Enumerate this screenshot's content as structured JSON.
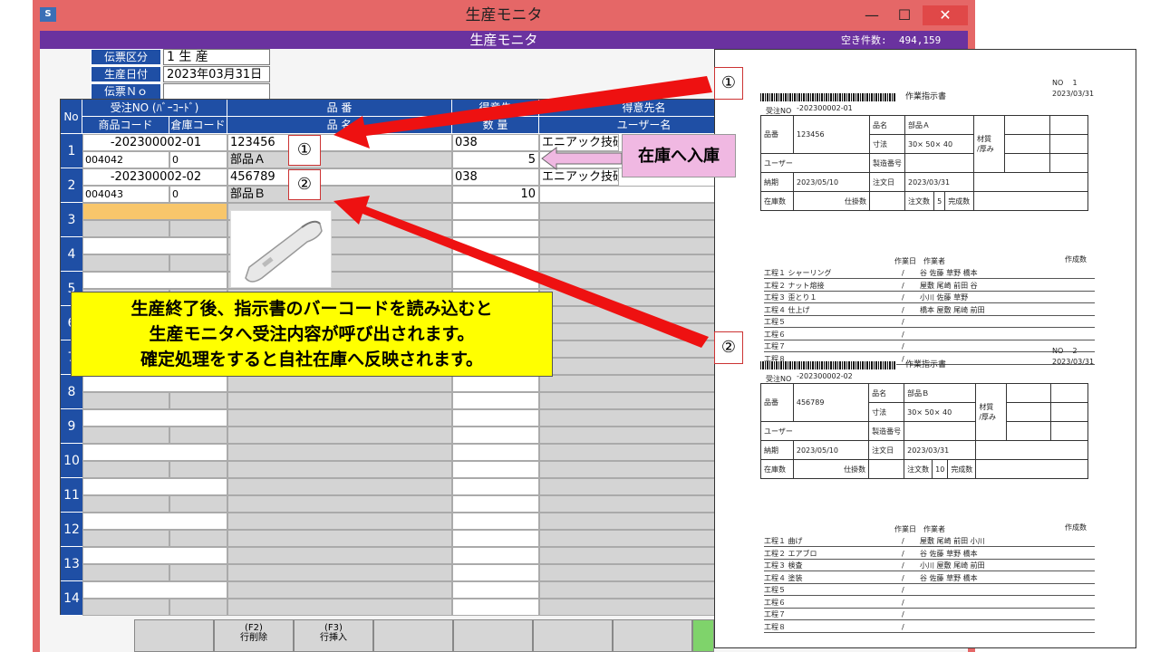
{
  "window": {
    "title": "生産モニタ",
    "subtitle": "生産モニタ",
    "free_label": "空き件数:",
    "free_count": "494,159",
    "logo": "S"
  },
  "header": {
    "fields": [
      {
        "label": "伝票区分",
        "value": "1  生  産"
      },
      {
        "label": "生産日付",
        "value": "2023年03月31日"
      },
      {
        "label": "伝票Ｎｏ",
        "value": ""
      }
    ]
  },
  "grid": {
    "headers_top": [
      "No",
      "受注NO (ﾊﾞｰｺｰﾄﾞ)",
      "品 番",
      "得意先",
      "得意先名"
    ],
    "headers_bottom": [
      "商品コード",
      "倉庫コード",
      "品 名",
      "数 量",
      "ユーザー名"
    ],
    "rows": [
      {
        "no": "1",
        "order": "-202300002-01",
        "product_code": "004042",
        "warehouse": "0",
        "part_no": "123456",
        "part_name": "部品Ａ",
        "customer": "038",
        "quantity": "5",
        "customer_name": "エニアック技研"
      },
      {
        "no": "2",
        "order": "-202300002-02",
        "product_code": "004043",
        "warehouse": "0",
        "part_no": "456789",
        "part_name": "部品Ｂ",
        "customer": "038",
        "quantity": "10",
        "customer_name": "エニアック技研"
      }
    ],
    "row_numbers": [
      "1",
      "2",
      "3",
      "4",
      "5",
      "6",
      "7",
      "8",
      "9",
      "10",
      "11",
      "12",
      "13",
      "14"
    ]
  },
  "buttons": [
    {
      "key": "(F2)",
      "label": "行削除"
    },
    {
      "key": "(F3)",
      "label": "行挿入"
    }
  ],
  "annotations": {
    "mark1": "①",
    "mark2": "②",
    "in_stock": "在庫へ入庫",
    "note": [
      "生産終了後、指示書のバーコードを読み込むと",
      "生産モニタへ受注内容が呼び出されます。",
      "確定処理をすると自社在庫へ反映されます。"
    ]
  },
  "sheets": [
    {
      "no_label": "NO",
      "no": "1",
      "title": "作業指示書",
      "date": "2023/03/31",
      "order_label": "受注NO",
      "order": "-202300002-01",
      "part_no_label": "品番",
      "part_no": "123456",
      "name_label": "品名",
      "name": "部品Ａ",
      "size_label": "寸法",
      "size": "30×   50×   40",
      "material_label": "材質\n/厚み",
      "user_label": "ユーザー",
      "serial_label": "製造番号",
      "due_label": "納期",
      "due": "2023/05/10",
      "order_date_label": "注文日",
      "order_date": "2023/03/31",
      "stock_label": "在庫数",
      "wip_label": "仕掛数",
      "qty_label": "注文数",
      "qty": "5",
      "done_label": "完成数",
      "work_date_label": "作業日",
      "worker_label": "作業者",
      "made_label": "作成数",
      "processes": [
        {
          "name": "工程１ シャーリング",
          "workers": "谷 佐藤 草野 橋本"
        },
        {
          "name": "工程２ ナット熔接",
          "workers": "屋敷 尾崎 前田 谷"
        },
        {
          "name": "工程３ 歪とり１",
          "workers": "小川 佐藤 草野"
        },
        {
          "name": "工程４ 仕上げ",
          "workers": "橋本 屋敷 尾崎 前田"
        },
        {
          "name": "工程５",
          "workers": ""
        },
        {
          "name": "工程６",
          "workers": ""
        },
        {
          "name": "工程７",
          "workers": ""
        },
        {
          "name": "工程８",
          "workers": ""
        }
      ]
    },
    {
      "no_label": "NO",
      "no": "2",
      "title": "作業指示書",
      "date": "2023/03/31",
      "order_label": "受注NO",
      "order": "-202300002-02",
      "part_no_label": "品番",
      "part_no": "456789",
      "name_label": "品名",
      "name": "部品Ｂ",
      "size_label": "寸法",
      "size": "30×   50×   40",
      "material_label": "材質\n/厚み",
      "user_label": "ユーザー",
      "serial_label": "製造番号",
      "due_label": "納期",
      "due": "2023/05/10",
      "order_date_label": "注文日",
      "order_date": "2023/03/31",
      "stock_label": "在庫数",
      "wip_label": "仕掛数",
      "qty_label": "注文数",
      "qty": "10",
      "done_label": "完成数",
      "work_date_label": "作業日",
      "worker_label": "作業者",
      "made_label": "作成数",
      "processes": [
        {
          "name": "工程１ 曲げ",
          "workers": "屋敷 尾崎 前田 小川"
        },
        {
          "name": "工程２ エアブロ",
          "workers": "谷 佐藤 草野 橋本"
        },
        {
          "name": "工程３ 検査",
          "workers": "小川 屋敷 尾崎 前田"
        },
        {
          "name": "工程４ 塗装",
          "workers": "谷 佐藤 草野 橋本"
        },
        {
          "name": "工程５",
          "workers": ""
        },
        {
          "name": "工程６",
          "workers": ""
        },
        {
          "name": "工程７",
          "workers": ""
        },
        {
          "name": "工程８",
          "workers": ""
        }
      ]
    }
  ],
  "colors": {
    "title_bar": "#e56767",
    "sub_bar": "#6a329f",
    "header_blue": "#1f4fa5",
    "arrow": "#ee1111",
    "note_bg": "#ffff00",
    "in_stock_bg": "#f0b8e2",
    "selected_cell": "#f8c66b"
  }
}
